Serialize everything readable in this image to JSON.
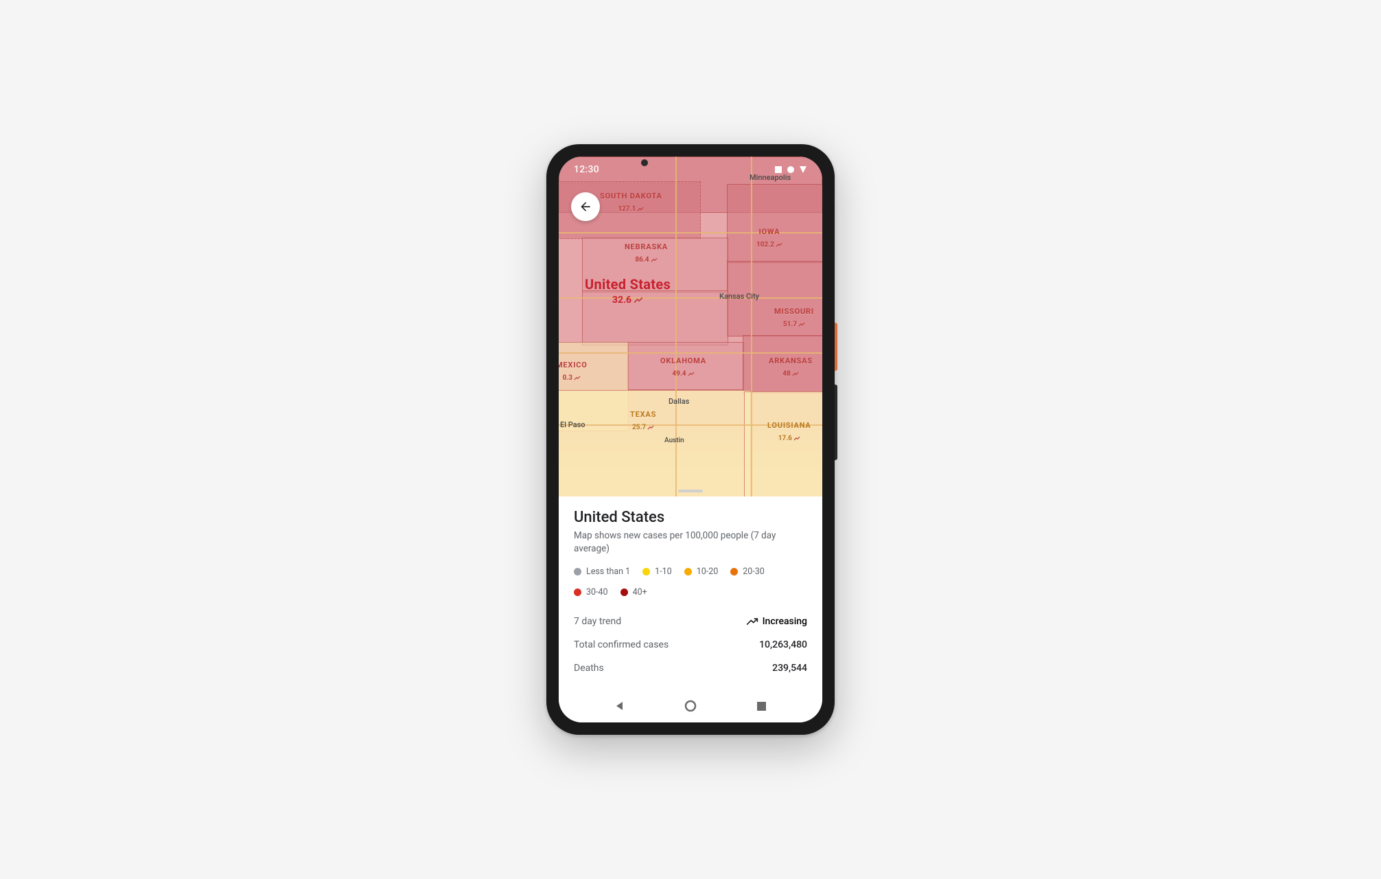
{
  "status_bar": {
    "time": "12:30"
  },
  "map": {
    "country": {
      "name": "United States",
      "value": "32.6"
    },
    "states": [
      {
        "name": "SOUTH DAKOTA",
        "value": "127.1"
      },
      {
        "name": "NEBRASKA",
        "value": "86.4"
      },
      {
        "name": "IOWA",
        "value": "102.2"
      },
      {
        "name": "MISSOURI",
        "value": "51.7"
      },
      {
        "name": "MEXICO",
        "value": "0.3"
      },
      {
        "name": "OKLAHOMA",
        "value": "49.4"
      },
      {
        "name": "ARKANSAS",
        "value": "48"
      },
      {
        "name": "TEXAS",
        "value": "25.7"
      },
      {
        "name": "LOUISIANA",
        "value": "17.6"
      }
    ],
    "cities": [
      {
        "name": "Minneapolis"
      },
      {
        "name": "Kansas City"
      },
      {
        "name": "Dallas"
      },
      {
        "name": "El Paso"
      },
      {
        "name": "Austin"
      }
    ]
  },
  "card": {
    "title": "United States",
    "subtitle": "Map shows new cases per 100,000 people (7 day average)",
    "legend": [
      {
        "label": "Less than 1",
        "color": "#9aa0a6"
      },
      {
        "label": "1-10",
        "color": "#fbd409"
      },
      {
        "label": "10-20",
        "color": "#f9ab00"
      },
      {
        "label": "20-30",
        "color": "#e8710a"
      },
      {
        "label": "30-40",
        "color": "#d93025"
      },
      {
        "label": "40+",
        "color": "#a50e0e"
      }
    ],
    "trend": {
      "label": "7 day trend",
      "value": "Increasing"
    },
    "confirmed": {
      "label": "Total confirmed cases",
      "value": "10,263,480"
    },
    "deaths": {
      "label": "Deaths",
      "value": "239,544"
    }
  }
}
